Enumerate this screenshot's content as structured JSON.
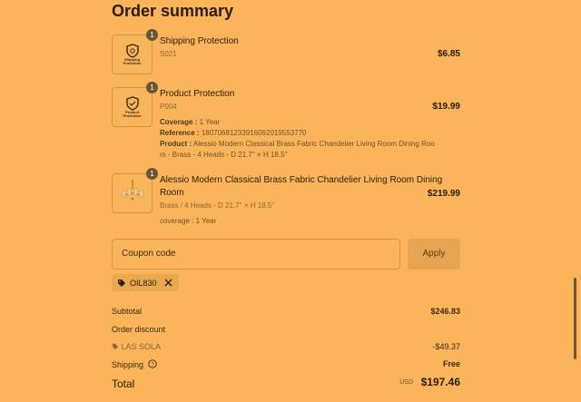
{
  "header": {
    "title": "Order summary"
  },
  "items": [
    {
      "qty": "1",
      "name": "Shipping Protection",
      "sku": "S021",
      "price": "$6.85",
      "thumb_text": [
        "Shipping",
        "Protection"
      ]
    },
    {
      "qty": "1",
      "name": "Product Protection",
      "sku": "P004",
      "price": "$19.99",
      "thumb_text": [
        "Product",
        "Protection"
      ],
      "props": [
        {
          "key": "Coverage :",
          "value": "1 Year"
        },
        {
          "key": "Reference :",
          "value": "18070681233916062019553770"
        },
        {
          "key": "Product :",
          "value": "Alessio Modern Classical Brass Fabric Chandelier Living Room Dining Roo"
        }
      ],
      "product_line2": "m - Brass - 4 Heads - D 21.7'' × H 18.5''"
    },
    {
      "qty": "1",
      "name_line1": "Alessio Modern Classical Brass Fabric Chandelier Living Room Dining",
      "name_line2": "Room",
      "variant": "Brass / 4 Heads - D 21.7'' × H 18.5''",
      "price": "$219.99",
      "props": [
        {
          "key": "coverage :",
          "value": "1 Year"
        }
      ]
    }
  ],
  "coupon": {
    "placeholder": "Coupon code",
    "apply_label": "Apply",
    "applied_code": "OIL830"
  },
  "totals": {
    "subtotal_label": "Subtotal",
    "subtotal_value": "$246.83",
    "order_discount_label": "Order discount",
    "discount_code": "LAS SOLA",
    "discount_value": "-$49.37",
    "shipping_label": "Shipping",
    "shipping_value": "Free",
    "total_label": "Total",
    "currency": "USD",
    "total_value": "$197.46"
  },
  "colors": {
    "background": "#fbb45a",
    "badge": "#6b5637",
    "accent_text": "#2a1d08"
  },
  "icons": [
    "shield-icon",
    "tag-icon",
    "close-icon",
    "help-circle-icon",
    "chandelier-icon"
  ]
}
